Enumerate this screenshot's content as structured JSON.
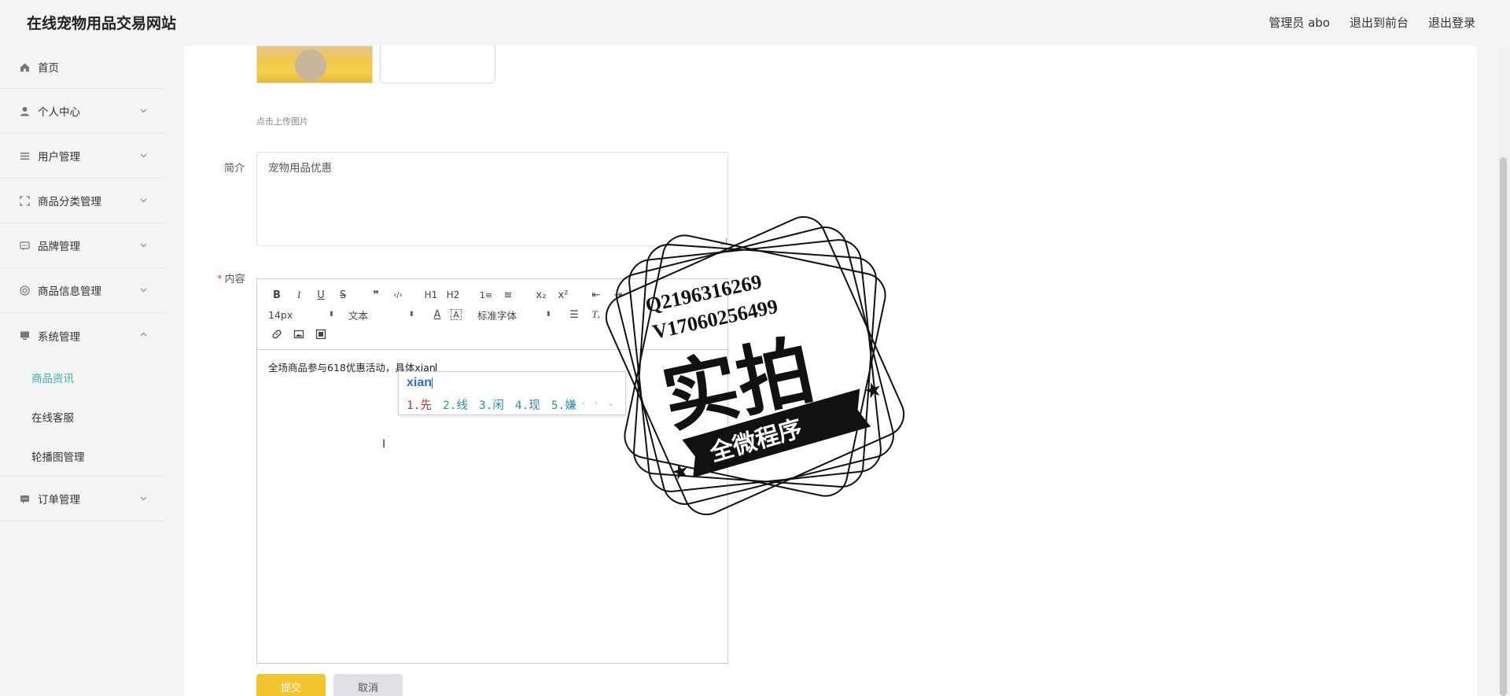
{
  "header": {
    "site_title": "在线宠物用品交易网站",
    "admin_label": "管理员 abo",
    "to_frontend": "退出到前台",
    "logout": "退出登录"
  },
  "sidebar": {
    "items": [
      {
        "label": "首页",
        "icon": "home-icon"
      },
      {
        "label": "个人中心",
        "icon": "user-icon"
      },
      {
        "label": "用户管理",
        "icon": "list-icon"
      },
      {
        "label": "商品分类管理",
        "icon": "fullscreen-icon"
      },
      {
        "label": "品牌管理",
        "icon": "chat-icon"
      },
      {
        "label": "商品信息管理",
        "icon": "target-icon"
      },
      {
        "label": "系统管理",
        "icon": "monitor-icon"
      }
    ],
    "system_sub": [
      {
        "label": "商品资讯",
        "active": true
      },
      {
        "label": "在线客服",
        "active": false
      },
      {
        "label": "轮播图管理",
        "active": false
      }
    ],
    "order": {
      "label": "订单管理",
      "icon": "message-icon"
    }
  },
  "form": {
    "upload_hint": "点击上传图片",
    "summary_label": "简介",
    "summary_value": "宠物用品优惠",
    "content_label": "内容",
    "required_mark": "*",
    "editor": {
      "buttons_row1": [
        "B",
        "I",
        "U",
        "S",
        "❞",
        "‹/›",
        "H1",
        "H2",
        "1≡",
        "≡",
        "x₂",
        "x²",
        "⇤",
        "⇥"
      ],
      "font_size": "14px",
      "text_type": "文本",
      "font_family": "标准字体",
      "content": "全场商品参与618优惠活动，具体xian"
    },
    "submit": "提交",
    "cancel": "取消"
  },
  "ime": {
    "input": "xian",
    "candidates": [
      "1.先",
      "2.线",
      "3.闲",
      "4.现",
      "5.嫌"
    ]
  },
  "watermark": {
    "line1": "Q2196316269",
    "line2": "V17060256499",
    "big": "实拍",
    "banner": "全微程序"
  },
  "colors": {
    "accent": "#3cb0a7",
    "submit": "#f2c42d",
    "cancel": "#dfe1e6",
    "required": "#e64a3a"
  }
}
